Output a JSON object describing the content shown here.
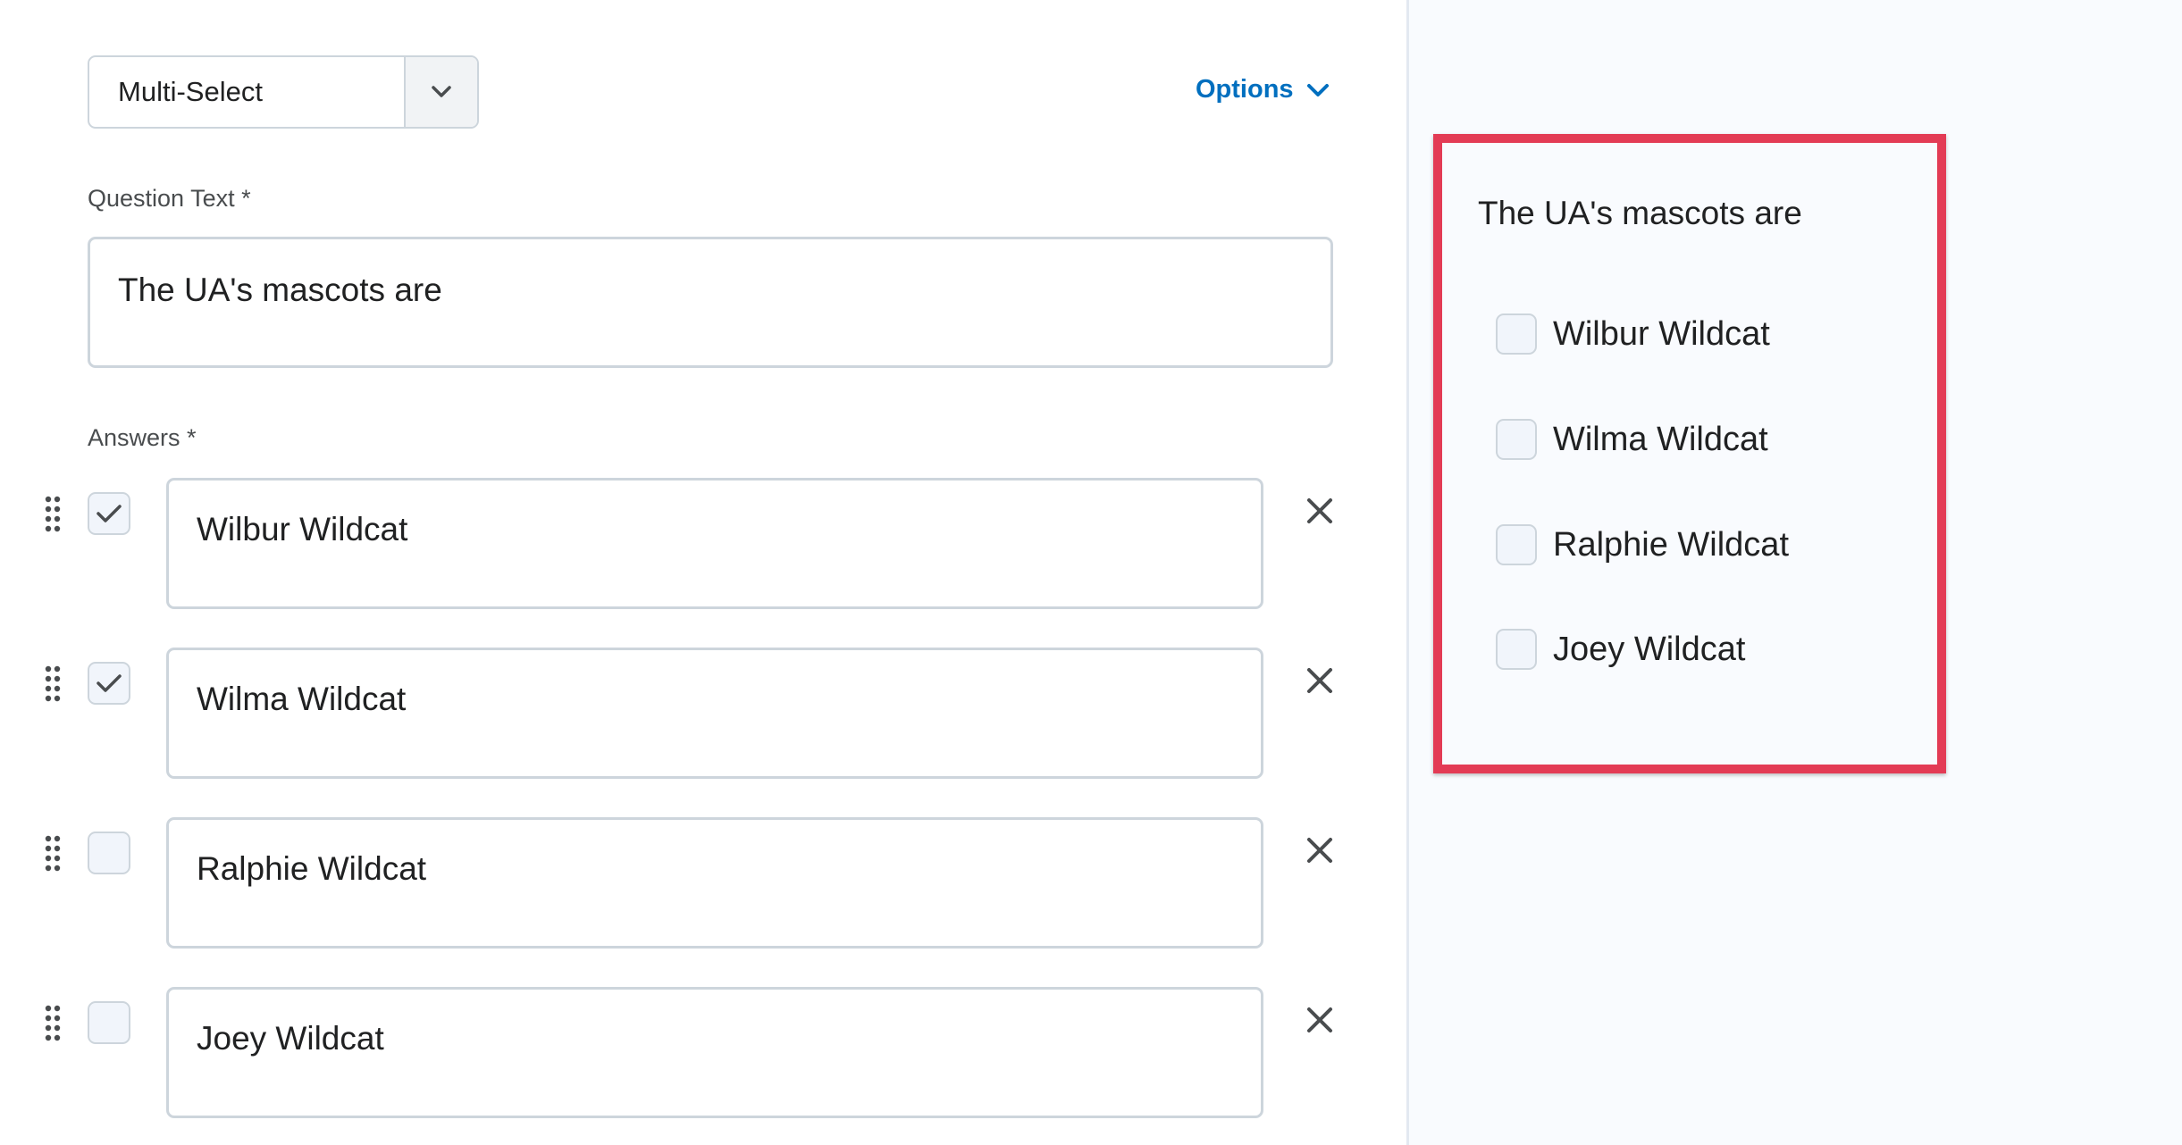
{
  "editor": {
    "question_type": {
      "value": "Multi-Select",
      "caret_icon": "chevron-down-icon"
    },
    "options_link": {
      "label": "Options",
      "icon": "chevron-down-icon",
      "color": "#006fbf"
    },
    "question_text": {
      "label": "Question Text *",
      "value": "The UA's mascots are"
    },
    "answers": {
      "label": "Answers *",
      "items": [
        {
          "text": "Wilbur Wildcat",
          "correct": true
        },
        {
          "text": "Wilma Wildcat",
          "correct": true
        },
        {
          "text": "Ralphie Wildcat",
          "correct": false
        },
        {
          "text": "Joey Wildcat",
          "correct": false
        }
      ]
    }
  },
  "preview": {
    "highlight_color": "#e33b55",
    "question": "The UA's mascots are",
    "options": [
      {
        "label": "Wilbur Wildcat"
      },
      {
        "label": "Wilma Wildcat"
      },
      {
        "label": "Ralphie Wildcat"
      },
      {
        "label": "Joey Wildcat"
      }
    ]
  }
}
